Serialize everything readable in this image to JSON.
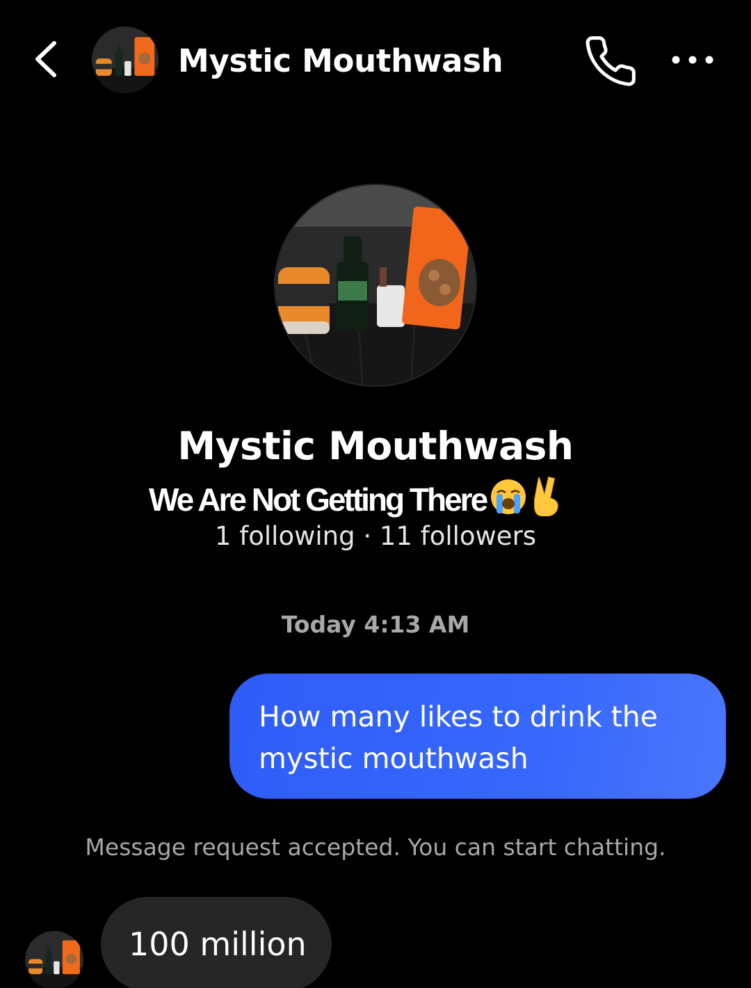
{
  "header": {
    "title": "Mystic Mouthwash",
    "back_icon": "chevron-left-icon",
    "call_icon": "phone-icon",
    "more_icon": "more-horizontal-icon"
  },
  "profile": {
    "name": "Mystic Mouthwash",
    "stats": "1 following · 11 followers"
  },
  "overlay": {
    "caption": "We Are Not Getting There",
    "emojis": [
      "loudly-crying-face-emoji",
      "victory-hand-emoji"
    ]
  },
  "chat": {
    "timestamp": "Today 4:13 AM",
    "sent_message": "How many likes to drink the mystic mouthwash",
    "system_note": "Message request accepted. You can start chatting.",
    "received_message": "100 million"
  },
  "colors": {
    "background": "#000000",
    "sent_bubble": "#3366fa",
    "received_bubble": "#262626",
    "muted_text": "#a8a8a8"
  }
}
